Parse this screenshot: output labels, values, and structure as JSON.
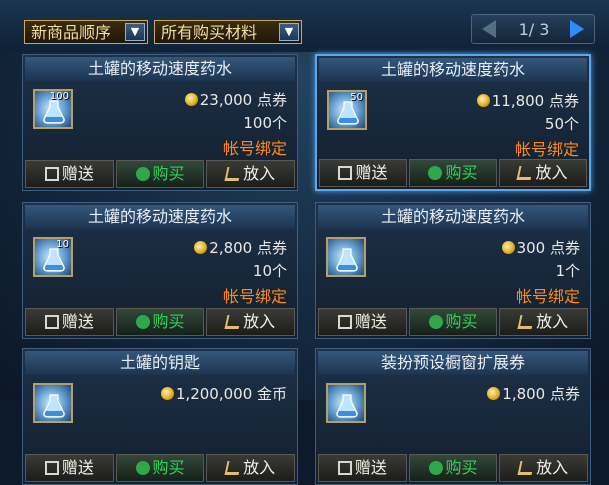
{
  "filters": {
    "sort_label": "新商品顺序",
    "category_label": "所有购买材料"
  },
  "pager": {
    "text": "1/ 3"
  },
  "buttons": {
    "gift": "赠送",
    "buy": "购买",
    "cart": "放入"
  },
  "items": [
    {
      "title": "土罐的移动速度药水",
      "qty": "100",
      "price": "23,000 点券",
      "count": "100个",
      "bind": "帐号绑定",
      "selected": false
    },
    {
      "title": "土罐的移动速度药水",
      "qty": "50",
      "price": "11,800 点券",
      "count": "50个",
      "bind": "帐号绑定",
      "selected": true
    },
    {
      "title": "土罐的移动速度药水",
      "qty": "10",
      "price": "2,800 点券",
      "count": "10个",
      "bind": "帐号绑定",
      "selected": false
    },
    {
      "title": "土罐的移动速度药水",
      "qty": "",
      "price": "300 点券",
      "count": "1个",
      "bind": "帐号绑定",
      "selected": false
    },
    {
      "title": "土罐的钥匙",
      "qty": "",
      "price": "1,200,000 金币",
      "count": "",
      "bind": "",
      "selected": false
    },
    {
      "title": "装扮预设橱窗扩展券",
      "qty": "",
      "price": "1,800 点券",
      "count": "",
      "bind": "",
      "selected": false
    }
  ],
  "colors": {
    "bind_text": "#ff8a1e",
    "buy_text": "#2fd25a",
    "selected_border": "#5aa7ea"
  }
}
